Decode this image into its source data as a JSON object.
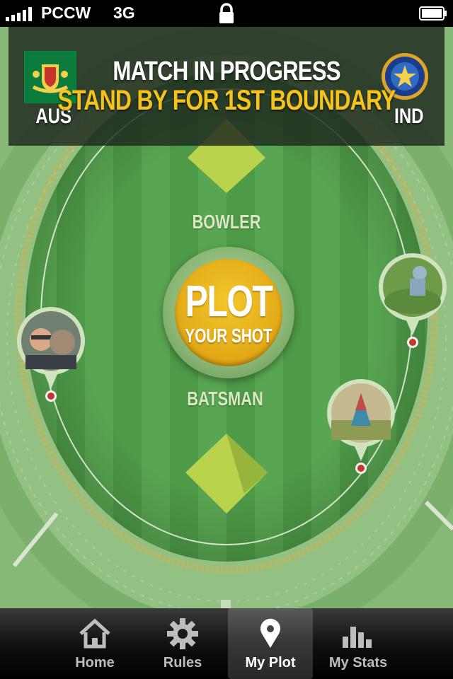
{
  "status_bar": {
    "carrier": "PCCW",
    "network": "3G"
  },
  "header": {
    "title": "MATCH IN PROGRESS",
    "subtitle": "STAND BY FOR 1ST BOUNDARY",
    "team_left": "AUS",
    "team_right": "IND"
  },
  "field": {
    "bowler_label": "BOWLER",
    "batsman_label": "BATSMAN",
    "plot_title": "PLOT",
    "plot_subtitle": "YOUR SHOT"
  },
  "tabs": [
    {
      "label": "Home",
      "icon": "home-icon",
      "active": false
    },
    {
      "label": "Rules",
      "icon": "gear-icon",
      "active": false
    },
    {
      "label": "My Plot",
      "icon": "location-pin-icon",
      "active": true
    },
    {
      "label": "My Stats",
      "icon": "bar-chart-icon",
      "active": false
    }
  ],
  "colors": {
    "accent_yellow": "#f6c21c",
    "grass": "#5fa35a",
    "pin_red": "#c0392b"
  }
}
